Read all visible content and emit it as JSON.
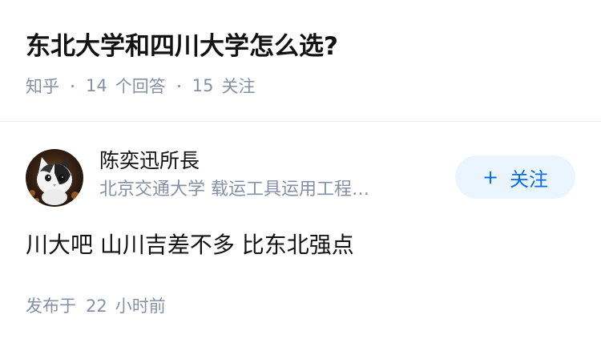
{
  "question": {
    "title": "东北大学和四川大学怎么选?",
    "source": "知乎",
    "answer_count": "14",
    "answer_unit": "个回答",
    "follow_count": "15",
    "follow_unit": "关注"
  },
  "answer": {
    "author": {
      "name": "陈奕迅所長",
      "headline": "北京交通大学 载运工具运用工程…",
      "avatar_icon": "cat-avatar-icon"
    },
    "follow_button": {
      "plus": "+",
      "label": "关注"
    },
    "content": "川大吧 山川吉差不多 比东北强点",
    "time_prefix": "发布于",
    "time_value": "22",
    "time_unit": "小时前"
  },
  "colors": {
    "text": "#121212",
    "muted": "#8590a6",
    "accent": "#056de8",
    "button_bg": "#ebf5ff",
    "divider": "#ebebeb"
  }
}
